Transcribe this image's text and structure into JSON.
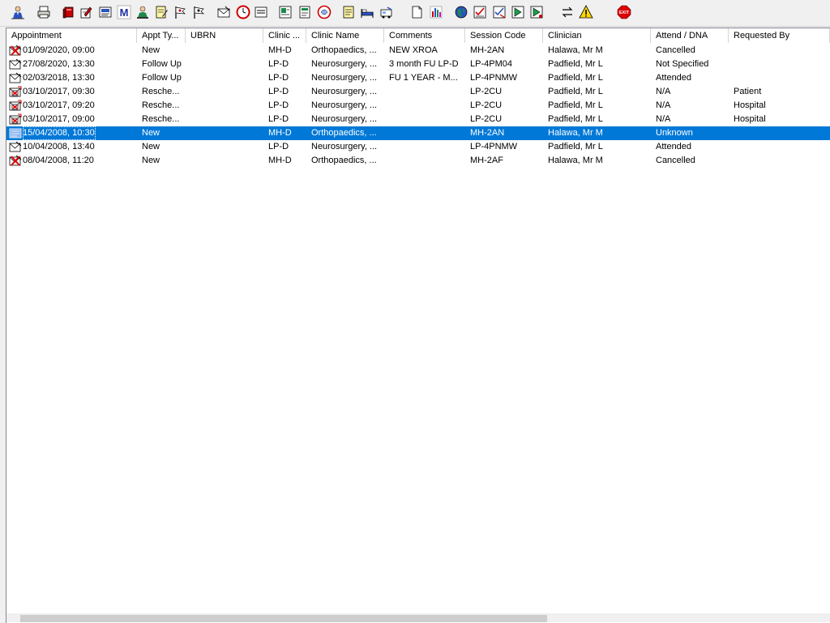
{
  "toolbar": {
    "buttons": [
      {
        "name": "patient-icon"
      },
      {
        "name": "print-icon"
      },
      {
        "name": "book-icon"
      },
      {
        "name": "edit-icon"
      },
      {
        "name": "referral-icon"
      },
      {
        "name": "letter-m-icon"
      },
      {
        "name": "clinician-icon"
      },
      {
        "name": "notes-icon"
      },
      {
        "name": "flag-icon"
      },
      {
        "name": "flag-alt-icon"
      },
      {
        "name": "envelope-icon"
      },
      {
        "name": "clock-icon"
      },
      {
        "name": "list-icon"
      },
      {
        "name": "image-icon"
      },
      {
        "name": "document-icon"
      },
      {
        "name": "no-entry-icon"
      },
      {
        "name": "note-icon"
      },
      {
        "name": "bed-icon"
      },
      {
        "name": "transport-icon"
      },
      {
        "name": "page-icon"
      },
      {
        "name": "chart-icon"
      },
      {
        "name": "globe-icon"
      },
      {
        "name": "tick-list-icon"
      },
      {
        "name": "tick-list-alt-icon"
      },
      {
        "name": "green-arrow-icon"
      },
      {
        "name": "green-arrow-alt-icon"
      },
      {
        "name": "swap-icon"
      },
      {
        "name": "warning-icon"
      },
      {
        "name": "exit-icon",
        "label": "EXIT"
      }
    ]
  },
  "table": {
    "columns": [
      {
        "key": "appointment",
        "label": "Appointment"
      },
      {
        "key": "appt_type",
        "label": "Appt Ty..."
      },
      {
        "key": "ubrn",
        "label": "UBRN"
      },
      {
        "key": "clinic",
        "label": "Clinic ..."
      },
      {
        "key": "clinic_name",
        "label": "Clinic Name"
      },
      {
        "key": "comments",
        "label": "Comments"
      },
      {
        "key": "session_code",
        "label": "Session Code"
      },
      {
        "key": "clinician",
        "label": "Clinician"
      },
      {
        "key": "attend",
        "label": "Attend / DNA"
      },
      {
        "key": "requested_by",
        "label": "Requested By"
      }
    ],
    "rows": [
      {
        "icon": "cancelled-appointment-icon",
        "selected": false,
        "appointment": "01/09/2020, 09:00",
        "appt_type": "New",
        "ubrn": "",
        "clinic": "MH-D",
        "clinic_name": "Orthopaedics, ...",
        "comments": "NEW XROA",
        "session_code": "MH-2AN",
        "clinician": "Halawa, Mr M",
        "attend": "Cancelled",
        "requested_by": ""
      },
      {
        "icon": "appointment-icon",
        "selected": false,
        "appointment": "27/08/2020, 13:30",
        "appt_type": "Follow Up",
        "ubrn": "",
        "clinic": "LP-D",
        "clinic_name": "Neurosurgery, ...",
        "comments": "3 month FU LP-D",
        "session_code": "LP-4PM04",
        "clinician": "Padfield, Mr L",
        "attend": "Not Specified",
        "requested_by": ""
      },
      {
        "icon": "appointment-icon",
        "selected": false,
        "appointment": "02/03/2018, 13:30",
        "appt_type": "Follow Up",
        "ubrn": "",
        "clinic": "LP-D",
        "clinic_name": "Neurosurgery, ...",
        "comments": "FU 1 YEAR - M...",
        "session_code": "LP-4PNMW",
        "clinician": "Padfield, Mr L",
        "attend": "Attended",
        "requested_by": ""
      },
      {
        "icon": "rescheduled-appointment-icon",
        "selected": false,
        "appointment": "03/10/2017, 09:30",
        "appt_type": "Resche...",
        "ubrn": "",
        "clinic": "LP-D",
        "clinic_name": "Neurosurgery, ...",
        "comments": "",
        "session_code": "LP-2CU",
        "clinician": "Padfield, Mr L",
        "attend": "N/A",
        "requested_by": "Patient"
      },
      {
        "icon": "rescheduled-appointment-icon",
        "selected": false,
        "appointment": "03/10/2017, 09:20",
        "appt_type": "Resche...",
        "ubrn": "",
        "clinic": "LP-D",
        "clinic_name": "Neurosurgery, ...",
        "comments": "",
        "session_code": "LP-2CU",
        "clinician": "Padfield, Mr L",
        "attend": "N/A",
        "requested_by": "Hospital"
      },
      {
        "icon": "rescheduled-appointment-icon",
        "selected": false,
        "appointment": "03/10/2017, 09:00",
        "appt_type": "Resche...",
        "ubrn": "",
        "clinic": "LP-D",
        "clinic_name": "Neurosurgery, ...",
        "comments": "",
        "session_code": "LP-2CU",
        "clinician": "Padfield, Mr L",
        "attend": "N/A",
        "requested_by": "Hospital"
      },
      {
        "icon": "unknown-appointment-icon",
        "selected": true,
        "appointment": "15/04/2008, 10:30",
        "appt_type": "New",
        "ubrn": "",
        "clinic": "MH-D",
        "clinic_name": "Orthopaedics, ...",
        "comments": "",
        "session_code": "MH-2AN",
        "clinician": "Halawa, Mr M",
        "attend": "Unknown",
        "requested_by": ""
      },
      {
        "icon": "appointment-icon",
        "selected": false,
        "appointment": "10/04/2008, 13:40",
        "appt_type": "New",
        "ubrn": "",
        "clinic": "LP-D",
        "clinic_name": "Neurosurgery, ...",
        "comments": "",
        "session_code": "LP-4PNMW",
        "clinician": "Padfield, Mr L",
        "attend": "Attended",
        "requested_by": ""
      },
      {
        "icon": "cancelled-appointment-icon",
        "selected": false,
        "appointment": "08/04/2008, 11:20",
        "appt_type": "New",
        "ubrn": "",
        "clinic": "MH-D",
        "clinic_name": "Orthopaedics, ...",
        "comments": "",
        "session_code": "MH-2AF",
        "clinician": "Halawa, Mr M",
        "attend": "Cancelled",
        "requested_by": ""
      }
    ]
  }
}
